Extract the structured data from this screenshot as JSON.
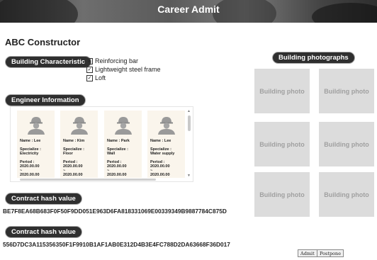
{
  "header": {
    "title": "Career Admit"
  },
  "company": {
    "name": "ABC Constructor"
  },
  "building": {
    "label": "Building Characteristic",
    "characteristics": [
      {
        "label": "Reinforcing bar",
        "checked": true
      },
      {
        "label": "Lightweight steel frame",
        "checked": true
      },
      {
        "label": "Loft",
        "checked": true
      }
    ]
  },
  "engineers": {
    "label": "Engineer Information",
    "cards": [
      {
        "name": "Name : Lee",
        "specialize_label": "Specialize :",
        "specialize": "Electricity",
        "period_label": "Period :",
        "period_start": "2020.00.00",
        "period_sep": "~",
        "period_end": "2020.00.00",
        "icon": "engineer-avatar-icon"
      },
      {
        "name": "Name : Kim",
        "specialize_label": "Specialize :",
        "specialize": "Floor",
        "period_label": "Period :",
        "period_start": "2020.00.00",
        "period_sep": "~",
        "period_end": "2020.00.00",
        "icon": "engineer-avatar-icon"
      },
      {
        "name": "Name : Park",
        "specialize_label": "Specialize :",
        "specialize": "Wall",
        "period_label": "Period :",
        "period_start": "2020.00.00",
        "period_sep": "~",
        "period_end": "2020.00.00",
        "icon": "engineer-avatar-icon"
      },
      {
        "name": "Name : Lee",
        "specialize_label": "Specialize :",
        "specialize": "Water supply",
        "period_label": "Period :",
        "period_start": "2020.00.00",
        "period_sep": "~",
        "period_end": "2020.00.00",
        "icon": "engineer-avatar-icon"
      }
    ]
  },
  "contracts": [
    {
      "label": "Contract hash value",
      "hash": "BE7F8EA68B683F0F50F9DD051E963D6FA818331069E00339349B9887784C875D"
    },
    {
      "label": "Contract hash value",
      "hash": "556D7DC3A115356350F1F9910B1AF1AB0E312D4B3E4FC788D2DA63668F36D017"
    }
  ],
  "photos": {
    "label": "Building photographs",
    "items": [
      "Building photo",
      "Building photo",
      "Building photo",
      "Building photo",
      "Building photo",
      "Building photo"
    ]
  },
  "actions": {
    "admit": "Admit",
    "postpone": "Postpone"
  },
  "colors": {
    "pill_bg": "#2f2f2f",
    "card_bg": "#faf5ec",
    "photo_bg": "#dcdcdc"
  }
}
